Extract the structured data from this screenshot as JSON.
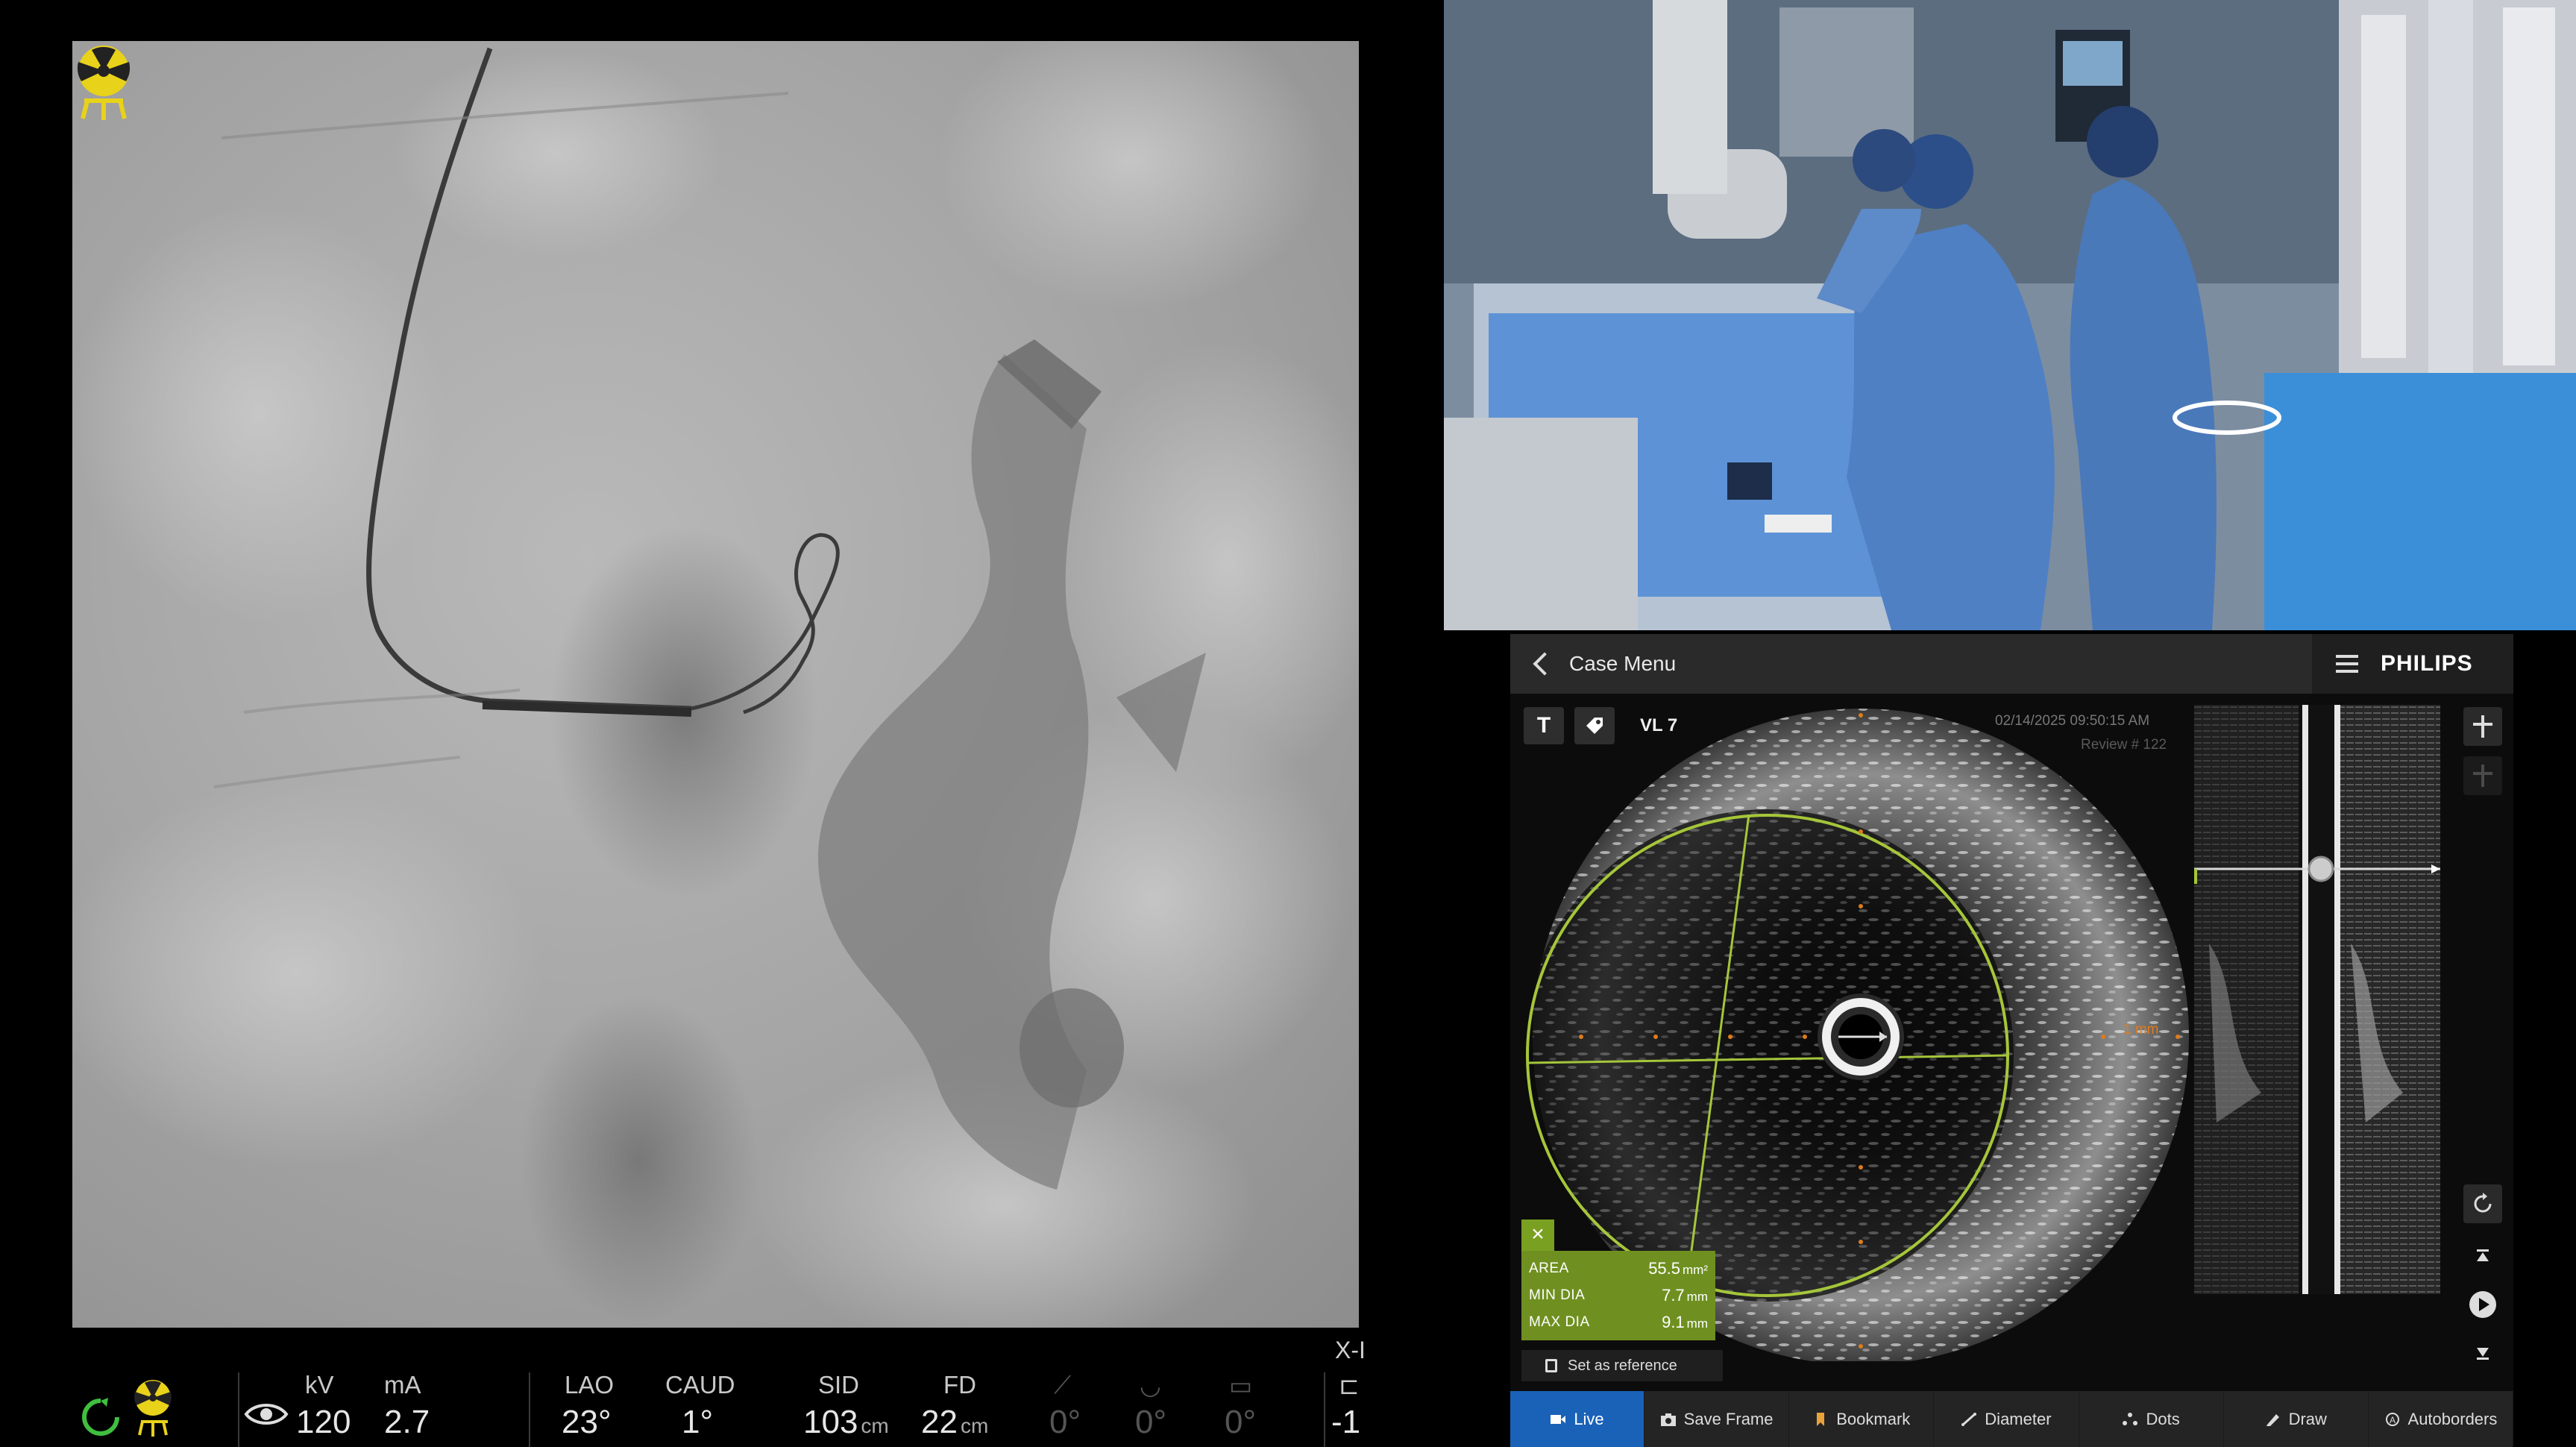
{
  "xray": {
    "corner_label": "X-I",
    "labels": {
      "kv": "kV",
      "ma": "mA",
      "lao": "LAO",
      "caud": "CAUD",
      "sid": "SID",
      "fd": "FD"
    },
    "values": {
      "kv": "120",
      "ma": "2.7",
      "lao": "23°",
      "caud": "1°",
      "sid": "103",
      "sid_unit": "cm",
      "fd": "22",
      "fd_unit": "cm",
      "dim1": "0°",
      "dim2": "0°",
      "dim3": "0°",
      "edge": "-1"
    },
    "icons": [
      "refresh-icon",
      "radiation-icon",
      "eye-icon",
      "radiation-warning-icon"
    ],
    "colors": {
      "status_green": "#3fbf3f",
      "warning_yellow": "#e8d21a"
    }
  },
  "ivus": {
    "header": {
      "back_label": "Case Menu",
      "brand": "PHILIPS"
    },
    "toolbar": {
      "text_tool": "T",
      "vl_label": "VL 7"
    },
    "datetime": "02/14/2025 09:50:15 AM",
    "review": "Review # 122",
    "scale_label": "1 mm",
    "measurements": [
      {
        "name": "AREA",
        "value": "55.5",
        "unit": "mm²"
      },
      {
        "name": "MIN DIA",
        "value": "7.7",
        "unit": "mm"
      },
      {
        "name": "MAX DIA",
        "value": "9.1",
        "unit": "mm"
      }
    ],
    "set_reference": "Set as reference",
    "bottom_bar": [
      {
        "label": "Live",
        "icon": "video-camera-icon"
      },
      {
        "label": "Save Frame",
        "icon": "camera-icon"
      },
      {
        "label": "Bookmark",
        "icon": "bookmark-icon"
      },
      {
        "label": "Diameter",
        "icon": "ruler-icon"
      },
      {
        "label": "Dots",
        "icon": "dots-icon"
      },
      {
        "label": "Draw",
        "icon": "draw-icon"
      },
      {
        "label": "Autoborders",
        "icon": "autoborders-icon"
      }
    ],
    "colors": {
      "accent_green": "#a5c63a",
      "live_blue": "#1a62b8",
      "scale_orange": "#e07b1a"
    }
  }
}
